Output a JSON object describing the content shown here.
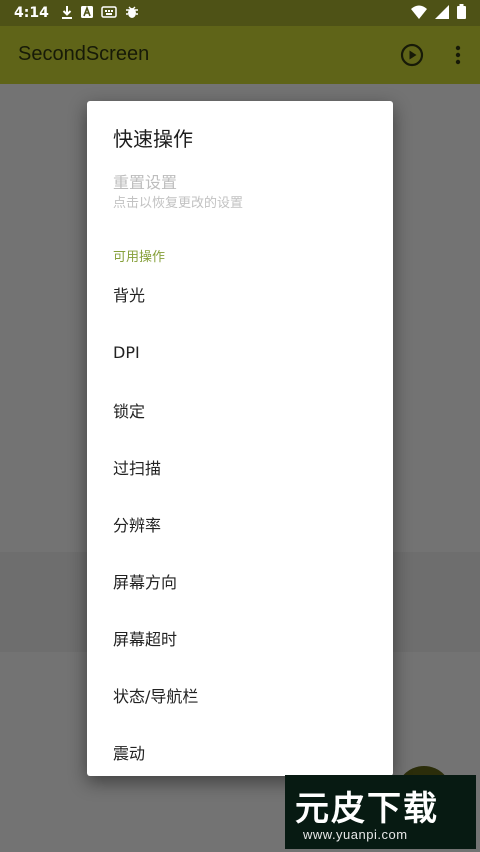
{
  "status_bar": {
    "time": "4:14",
    "icons": [
      "download-icon",
      "a-icon",
      "keyboard-icon",
      "bug-icon",
      "wifi-icon",
      "signal-icon",
      "battery-icon"
    ]
  },
  "app_bar": {
    "title": "SecondScreen",
    "actions": [
      "play-icon",
      "more-vert-icon"
    ]
  },
  "dialog": {
    "title": "快速操作",
    "reset": {
      "title": "重置设置",
      "summary": "点击以恢复更改的设置"
    },
    "category_label": "可用操作",
    "items": [
      {
        "label": "背光"
      },
      {
        "label": "DPI"
      },
      {
        "label": "锁定"
      },
      {
        "label": "过扫描"
      },
      {
        "label": "分辨率"
      },
      {
        "label": "屏幕方向"
      },
      {
        "label": "屏幕超时"
      },
      {
        "label": "状态/导航栏"
      },
      {
        "label": "震动"
      }
    ]
  },
  "watermark": {
    "text": "元皮下载",
    "url": "www.yuanpi.com"
  },
  "colors": {
    "app_bar": "#5f6418",
    "status_bar": "#4e5216",
    "accent": "#86a03a"
  }
}
